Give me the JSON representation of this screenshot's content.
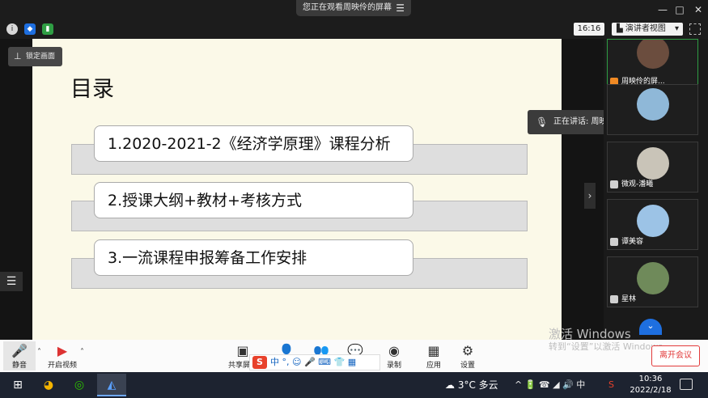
{
  "window": {
    "banner": "您正在观看周映伶的屏幕",
    "controls": [
      "—",
      "□",
      "✕"
    ]
  },
  "statusbar": {
    "icons": [
      "info-icon",
      "shield-icon",
      "signal-icon"
    ],
    "time": "16:16",
    "view_label": "演讲者视图",
    "view_caret": "▾"
  },
  "slide": {
    "title": "目录",
    "items": [
      "1.2020-2021-2《经济学原理》课程分析",
      "2.授课大纲+教材+考核方式",
      "3.一流课程申报筹备工作安排"
    ]
  },
  "overlay": {
    "lock_label": "锁定画面",
    "speaking_label": "正在讲话: 周映伶;"
  },
  "participants": [
    {
      "name": "周映伶的屏...",
      "avatar_color": "#6b4d3e"
    },
    {
      "name": "",
      "avatar_color": "#8fb8d8"
    },
    {
      "name": "微观-潘曦",
      "avatar_color": "#c9c4b8"
    },
    {
      "name": "谭美容",
      "avatar_color": "#9cc3e6"
    },
    {
      "name": "星林",
      "avatar_color": "#6f8a5a"
    }
  ],
  "toolbar": {
    "mute_label": "静音",
    "video_label": "开启视频",
    "share_label": "共享屏幕",
    "record_label": "录制",
    "apps_label": "应用",
    "settings_label": "设置",
    "leave_label": "离开会议",
    "ime_text": "中 °, ☺ 🎤 ⌨ 👕 ▦"
  },
  "watermark": {
    "line1": "激活 Windows",
    "line2": "转到“设置”以激活 Windows。"
  },
  "taskbar": {
    "weather": "3°C 多云",
    "tray": "^ 🔋 ☎ ◢ 🔊 中",
    "time": "10:36",
    "date": "2022/2/18"
  },
  "colors": {
    "slide_bg": "#fbf9e8",
    "accent_blue": "#1e6fe0",
    "leave_red": "#e23b3b"
  }
}
